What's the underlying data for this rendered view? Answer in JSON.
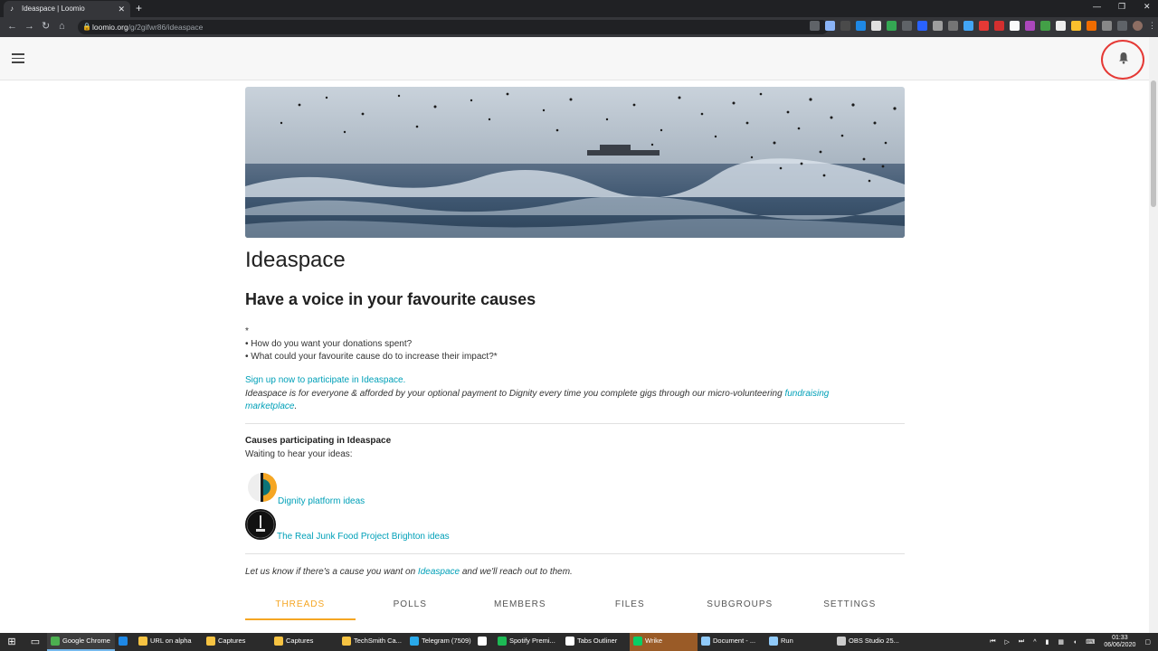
{
  "browser": {
    "tab_title": "Ideaspace | Loomio",
    "new_tab": "+",
    "url_host": "loomio.org",
    "url_path": "/g/2gifwr86/ideaspace",
    "minimize": "—",
    "maximize": "❐",
    "close": "✕"
  },
  "group": {
    "name": "Ideaspace",
    "tagline": "Have a voice in your favourite causes",
    "desc_star": "*",
    "desc_q1": "• How do you want your donations spent?",
    "desc_q2": "• What could your favourite cause do to increase their impact?*",
    "signup_link": "Sign up now to participate in Ideaspace.",
    "note_prefix": "Ideaspace is for everyone & afforded by your optional payment to Dignity every time you complete gigs through our micro-volunteering ",
    "note_link": "fundraising marketplace",
    "note_suffix": "."
  },
  "causes": {
    "heading": "Causes participating in Ideaspace",
    "subheading": "Waiting to hear your ideas:",
    "items": [
      {
        "label": "Dignity platform ideas"
      },
      {
        "label": "The Real Junk Food Project Brighton ideas"
      }
    ],
    "cta_prefix": "Let us know if there's a cause you want on ",
    "cta_link": "Ideaspace",
    "cta_suffix": " and we'll reach out to them."
  },
  "tabs": [
    {
      "label": "THREADS",
      "active": true
    },
    {
      "label": "POLLS"
    },
    {
      "label": "MEMBERS"
    },
    {
      "label": "FILES"
    },
    {
      "label": "SUBGROUPS"
    },
    {
      "label": "SETTINGS"
    }
  ],
  "taskbar": {
    "items": [
      {
        "label": "Google Chrome",
        "color": "#4caf50"
      },
      {
        "label": "",
        "color": "#1e88e5"
      },
      {
        "label": "URL on alpha",
        "color": "#f6c342"
      },
      {
        "label": "Captures",
        "color": "#f6c342"
      },
      {
        "label": "Captures",
        "color": "#f6c342"
      },
      {
        "label": "TechSmith Ca...",
        "color": "#f6c342"
      },
      {
        "label": "Telegram (7509)",
        "color": "#29a9ea"
      },
      {
        "label": "",
        "color": "#ffffff"
      },
      {
        "label": "Spotify Premi...",
        "color": "#1db954"
      },
      {
        "label": "Tabs Outliner",
        "color": "#ffffff"
      },
      {
        "label": "Wrike",
        "color": "#08cf65"
      },
      {
        "label": "Document - ...",
        "color": "#90caf9"
      },
      {
        "label": "Run",
        "color": "#90caf9"
      },
      {
        "label": "OBS Studio 25...",
        "color": "#cccccc"
      }
    ],
    "time": "01:33",
    "date": "06/06/2020"
  },
  "colors": {
    "accent": "#f5a623",
    "link": "#00a0b8",
    "annotation_ring": "#e53935"
  }
}
